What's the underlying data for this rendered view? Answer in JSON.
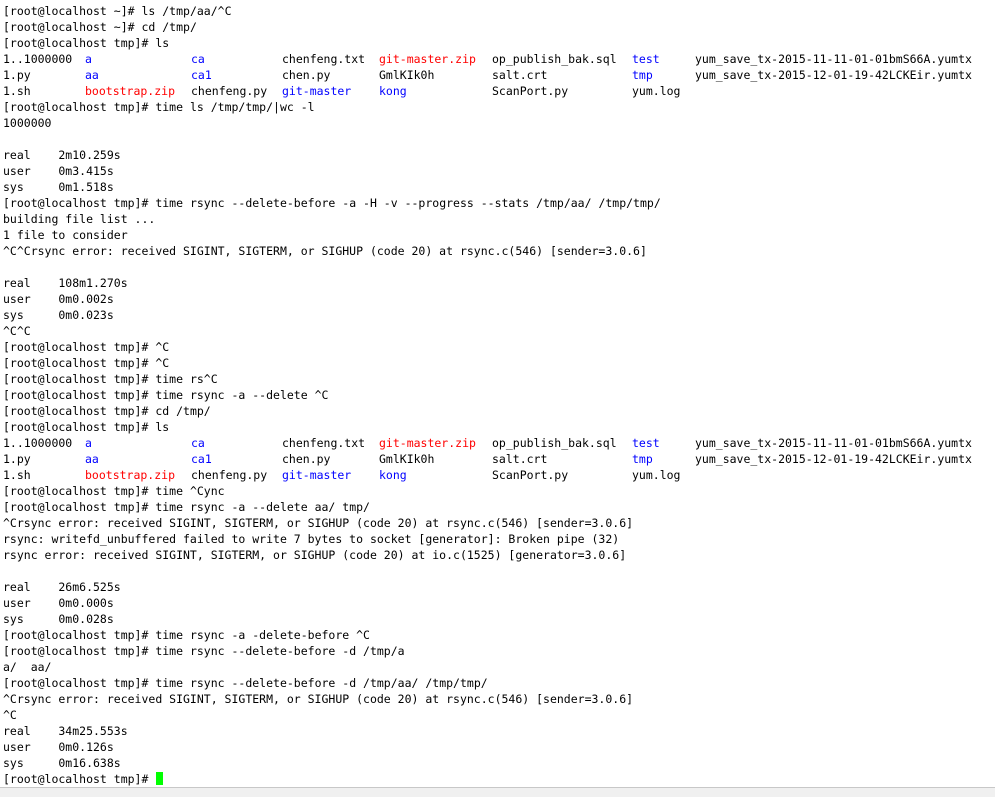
{
  "terminal": {
    "prompt_home": "[root@localhost ~]# ",
    "prompt_tmp": "[root@localhost tmp]# ",
    "colors": {
      "text": "#000000",
      "directory": "#0000ff",
      "archive": "#ff0000",
      "cursor": "#00ff00",
      "background": "#ffffff"
    },
    "lines": [
      {
        "kind": "prompt",
        "prompt": "[root@localhost ~]# ",
        "cmd": "ls /tmp/aa/^C"
      },
      {
        "kind": "prompt",
        "prompt": "[root@localhost ~]# ",
        "cmd": "cd /tmp/"
      },
      {
        "kind": "prompt",
        "prompt": "[root@localhost tmp]# ",
        "cmd": "ls"
      },
      {
        "kind": "ls",
        "cells": [
          {
            "text": "1..1000000",
            "color": "#000000"
          },
          {
            "text": "a",
            "color": "#0000ff"
          },
          {
            "text": "ca",
            "color": "#0000ff"
          },
          {
            "text": "chenfeng.txt",
            "color": "#000000"
          },
          {
            "text": "git-master.zip",
            "color": "#ff0000"
          },
          {
            "text": "op_publish_bak.sql",
            "color": "#000000"
          },
          {
            "text": "test",
            "color": "#0000ff"
          },
          {
            "text": "yum_save_tx-2015-11-11-01-01bmS66A.yumtx",
            "color": "#000000"
          }
        ]
      },
      {
        "kind": "ls",
        "cells": [
          {
            "text": "1.py",
            "color": "#000000"
          },
          {
            "text": "aa",
            "color": "#0000ff"
          },
          {
            "text": "ca1",
            "color": "#0000ff"
          },
          {
            "text": "chen.py",
            "color": "#000000"
          },
          {
            "text": "GmlKIk0h",
            "color": "#000000"
          },
          {
            "text": "salt.crt",
            "color": "#000000"
          },
          {
            "text": "tmp",
            "color": "#0000ff"
          },
          {
            "text": "yum_save_tx-2015-12-01-19-42LCKEir.yumtx",
            "color": "#000000"
          }
        ]
      },
      {
        "kind": "ls",
        "cells": [
          {
            "text": "1.sh",
            "color": "#000000"
          },
          {
            "text": "bootstrap.zip",
            "color": "#ff0000"
          },
          {
            "text": "chenfeng.py",
            "color": "#000000"
          },
          {
            "text": "git-master",
            "color": "#0000ff"
          },
          {
            "text": "kong",
            "color": "#0000ff"
          },
          {
            "text": "ScanPort.py",
            "color": "#000000"
          },
          {
            "text": "yum.log",
            "color": "#000000"
          },
          {
            "text": "",
            "color": "#000000"
          }
        ]
      },
      {
        "kind": "prompt",
        "prompt": "[root@localhost tmp]# ",
        "cmd": "time ls /tmp/tmp/|wc -l"
      },
      {
        "kind": "text",
        "text": "1000000"
      },
      {
        "kind": "text",
        "text": ""
      },
      {
        "kind": "text",
        "text": "real    2m10.259s"
      },
      {
        "kind": "text",
        "text": "user    0m3.415s"
      },
      {
        "kind": "text",
        "text": "sys     0m1.518s"
      },
      {
        "kind": "prompt",
        "prompt": "[root@localhost tmp]# ",
        "cmd": "time rsync --delete-before -a -H -v --progress --stats /tmp/aa/ /tmp/tmp/"
      },
      {
        "kind": "text",
        "text": "building file list ..."
      },
      {
        "kind": "text",
        "text": "1 file to consider"
      },
      {
        "kind": "text",
        "text": "^C^Crsync error: received SIGINT, SIGTERM, or SIGHUP (code 20) at rsync.c(546) [sender=3.0.6]"
      },
      {
        "kind": "text",
        "text": ""
      },
      {
        "kind": "text",
        "text": "real    108m1.270s"
      },
      {
        "kind": "text",
        "text": "user    0m0.002s"
      },
      {
        "kind": "text",
        "text": "sys     0m0.023s"
      },
      {
        "kind": "text",
        "text": "^C^C"
      },
      {
        "kind": "prompt",
        "prompt": "[root@localhost tmp]# ",
        "cmd": "^C"
      },
      {
        "kind": "prompt",
        "prompt": "[root@localhost tmp]# ",
        "cmd": "^C"
      },
      {
        "kind": "prompt",
        "prompt": "[root@localhost tmp]# ",
        "cmd": "time rs^C"
      },
      {
        "kind": "prompt",
        "prompt": "[root@localhost tmp]# ",
        "cmd": "time rsync -a --delete ^C"
      },
      {
        "kind": "prompt",
        "prompt": "[root@localhost tmp]# ",
        "cmd": "cd /tmp/"
      },
      {
        "kind": "prompt",
        "prompt": "[root@localhost tmp]# ",
        "cmd": "ls"
      },
      {
        "kind": "ls",
        "cells": [
          {
            "text": "1..1000000",
            "color": "#000000"
          },
          {
            "text": "a",
            "color": "#0000ff"
          },
          {
            "text": "ca",
            "color": "#0000ff"
          },
          {
            "text": "chenfeng.txt",
            "color": "#000000"
          },
          {
            "text": "git-master.zip",
            "color": "#ff0000"
          },
          {
            "text": "op_publish_bak.sql",
            "color": "#000000"
          },
          {
            "text": "test",
            "color": "#0000ff"
          },
          {
            "text": "yum_save_tx-2015-11-11-01-01bmS66A.yumtx",
            "color": "#000000"
          }
        ]
      },
      {
        "kind": "ls",
        "cells": [
          {
            "text": "1.py",
            "color": "#000000"
          },
          {
            "text": "aa",
            "color": "#0000ff"
          },
          {
            "text": "ca1",
            "color": "#0000ff"
          },
          {
            "text": "chen.py",
            "color": "#000000"
          },
          {
            "text": "GmlKIk0h",
            "color": "#000000"
          },
          {
            "text": "salt.crt",
            "color": "#000000"
          },
          {
            "text": "tmp",
            "color": "#0000ff"
          },
          {
            "text": "yum_save_tx-2015-12-01-19-42LCKEir.yumtx",
            "color": "#000000"
          }
        ]
      },
      {
        "kind": "ls",
        "cells": [
          {
            "text": "1.sh",
            "color": "#000000"
          },
          {
            "text": "bootstrap.zip",
            "color": "#ff0000"
          },
          {
            "text": "chenfeng.py",
            "color": "#000000"
          },
          {
            "text": "git-master",
            "color": "#0000ff"
          },
          {
            "text": "kong",
            "color": "#0000ff"
          },
          {
            "text": "ScanPort.py",
            "color": "#000000"
          },
          {
            "text": "yum.log",
            "color": "#000000"
          },
          {
            "text": "",
            "color": "#000000"
          }
        ]
      },
      {
        "kind": "prompt",
        "prompt": "[root@localhost tmp]# ",
        "cmd": "time ^Cync"
      },
      {
        "kind": "prompt",
        "prompt": "[root@localhost tmp]# ",
        "cmd": "time rsync -a --delete aa/ tmp/"
      },
      {
        "kind": "text",
        "text": "^Crsync error: received SIGINT, SIGTERM, or SIGHUP (code 20) at rsync.c(546) [sender=3.0.6]"
      },
      {
        "kind": "text",
        "text": "rsync: writefd_unbuffered failed to write 7 bytes to socket [generator]: Broken pipe (32)"
      },
      {
        "kind": "text",
        "text": "rsync error: received SIGINT, SIGTERM, or SIGHUP (code 20) at io.c(1525) [generator=3.0.6]"
      },
      {
        "kind": "text",
        "text": ""
      },
      {
        "kind": "text",
        "text": "real    26m6.525s"
      },
      {
        "kind": "text",
        "text": "user    0m0.000s"
      },
      {
        "kind": "text",
        "text": "sys     0m0.028s"
      },
      {
        "kind": "prompt",
        "prompt": "[root@localhost tmp]# ",
        "cmd": "time rsync -a -delete-before ^C"
      },
      {
        "kind": "prompt",
        "prompt": "[root@localhost tmp]# ",
        "cmd": "time rsync --delete-before -d /tmp/a"
      },
      {
        "kind": "text",
        "text": "a/  aa/"
      },
      {
        "kind": "prompt",
        "prompt": "[root@localhost tmp]# ",
        "cmd": "time rsync --delete-before -d /tmp/aa/ /tmp/tmp/"
      },
      {
        "kind": "text",
        "text": "^Crsync error: received SIGINT, SIGTERM, or SIGHUP (code 20) at rsync.c(546) [sender=3.0.6]"
      },
      {
        "kind": "text",
        "text": "^C"
      },
      {
        "kind": "text",
        "text": "real    34m25.553s"
      },
      {
        "kind": "text",
        "text": "user    0m0.126s"
      },
      {
        "kind": "text",
        "text": "sys     0m16.638s"
      },
      {
        "kind": "prompt",
        "prompt": "[root@localhost tmp]# ",
        "cmd": "",
        "cursor": true
      }
    ]
  }
}
